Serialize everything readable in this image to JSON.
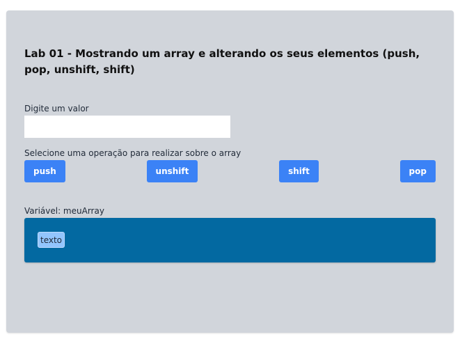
{
  "lab": {
    "title": "Lab 01 - Mostrando um array e alterando os seus elementos (push, pop, unshift, shift)"
  },
  "input": {
    "label": "Digite um valor",
    "value": "",
    "placeholder": ""
  },
  "operations": {
    "label": "Selecione uma operação para realizar sobre o array",
    "push_label": "push",
    "unshift_label": "unshift",
    "shift_label": "shift",
    "pop_label": "pop"
  },
  "variable": {
    "label": "Variável: meuArray",
    "items": [
      "texto"
    ]
  },
  "colors": {
    "card_bg": "#d1d5db",
    "button_bg": "#3b82f6",
    "array_bg": "#0369a1",
    "item_bg": "#93c5fd"
  }
}
